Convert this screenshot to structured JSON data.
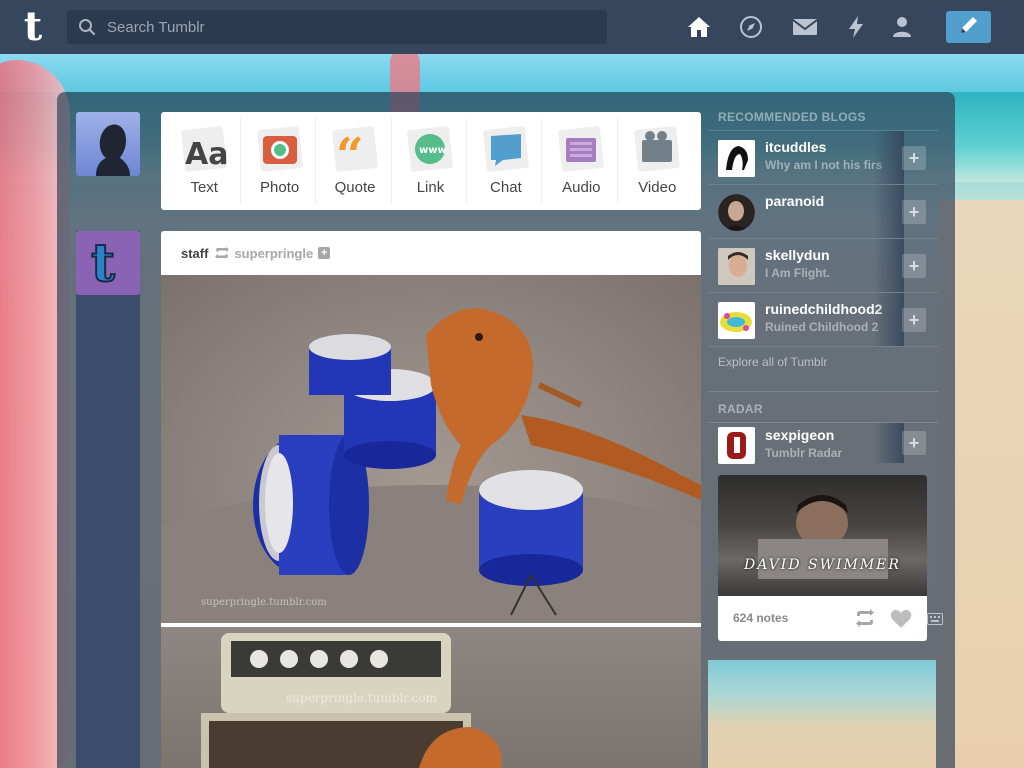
{
  "search": {
    "placeholder": "Search Tumblr"
  },
  "nav": {
    "icons": [
      "home-icon",
      "explore-icon",
      "inbox-icon",
      "activity-icon",
      "account-icon",
      "compose-icon"
    ]
  },
  "post_types": [
    {
      "label": "Text",
      "icon": "text-icon",
      "color": "#444444"
    },
    {
      "label": "Photo",
      "icon": "photo-icon",
      "color": "#d95e40"
    },
    {
      "label": "Quote",
      "icon": "quote-icon",
      "color": "#f2992e"
    },
    {
      "label": "Link",
      "icon": "link-icon",
      "color": "#56bc8a"
    },
    {
      "label": "Chat",
      "icon": "chat-icon",
      "color": "#529ecc"
    },
    {
      "label": "Audio",
      "icon": "audio-icon",
      "color": "#a77dc2"
    },
    {
      "label": "Video",
      "icon": "video-icon",
      "color": "#748089"
    }
  ],
  "post": {
    "author": "staff",
    "source": "superpringle",
    "watermark1": "superpringle.tumblr.com",
    "watermark2": "superpringle.tumblr.com"
  },
  "sidebar": {
    "recommended_heading": "RECOMMENDED BLOGS",
    "recommended": [
      {
        "name": "itcuddles",
        "desc": "Why am I not his firs"
      },
      {
        "name": "paranoid",
        "desc": ""
      },
      {
        "name": "skellydun",
        "desc": "I Am Flight."
      },
      {
        "name": "ruinedchildhood2",
        "desc": "Ruined Childhood 2"
      }
    ],
    "explore_link": "Explore all of Tumblr",
    "radar_heading": "RADAR",
    "radar": {
      "name": "sexpigeon",
      "desc": "Tumblr Radar",
      "caption": "DAVID SWIMMER",
      "notes": "624 notes"
    }
  },
  "colors": {
    "navy": "#36465d",
    "accent_blue": "#529ecc"
  }
}
